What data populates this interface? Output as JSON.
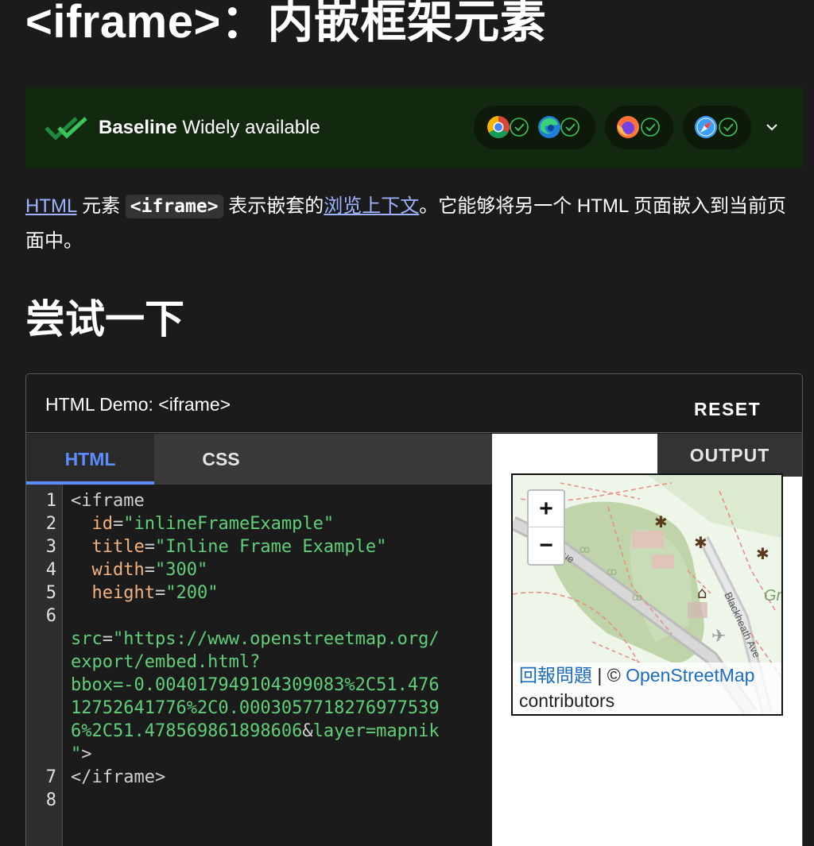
{
  "title": "<iframe>：内嵌框架元素",
  "baseline": {
    "label_bold": "Baseline",
    "label_rest": " Widely available",
    "browsers": [
      "chrome-icon",
      "edge-icon",
      "firefox-icon",
      "safari-icon"
    ]
  },
  "intro": {
    "link1": "HTML",
    "text1": " 元素 ",
    "code": "<iframe>",
    "text2": " 表示嵌套的",
    "link2": "浏览上下文",
    "text3": "。它能够将另一个 HTML 页面嵌入到当前页面中。"
  },
  "section_heading": "尝试一下",
  "demo": {
    "title": "HTML Demo: <iframe>",
    "reset_label": "RESET",
    "tabs": [
      "HTML",
      "CSS"
    ],
    "output_label": "OUTPUT",
    "line_numbers": [
      "1",
      "2",
      "3",
      "4",
      "5",
      "6",
      "7",
      "8"
    ],
    "code": {
      "l1_tag": "<iframe",
      "id_attr": "id",
      "id_val": "\"inlineFrameExample\"",
      "title_attr": "title",
      "title_val": "\"Inline Frame Example\"",
      "width_attr": "width",
      "width_val": "\"300\"",
      "height_attr": "height",
      "height_val": "\"200\"",
      "src_attr": "src",
      "src_val_1": "\"https://www.openstreetmap.org/",
      "src_val_2": "export/embed.html?",
      "src_val_3": "bbox=-0.004017949104309083%2C51.476",
      "src_val_4": "12752641776%2C0.0003057718276977539",
      "src_val_5a": "6%2C51.478569861898606",
      "src_amp": "&",
      "src_val_5b": "layer=mapnik",
      "src_val_6": "\"",
      "close_tag": "</iframe>"
    },
    "map": {
      "zoom_in": "+",
      "zoom_out": "−",
      "report_link": "回報問題",
      "separator": " | © ",
      "osm_link": "OpenStreetMap",
      "contributors": "contributors",
      "street_1": "venue",
      "street_2": "Blackheath Ave",
      "label_gr": "Gr"
    }
  }
}
